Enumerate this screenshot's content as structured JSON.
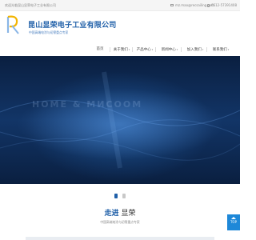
{
  "topbar": {
    "welcome": "欢迎光临昆山显荣电子工业有限公司",
    "email": "mz.mao@recsailing.com",
    "phone": "0512-57391408"
  },
  "logo": {
    "company_name": "昆山显荣电子工业有限公司",
    "slogan": "中国高端电涂与初筛重点专家"
  },
  "nav": {
    "items": [
      {
        "label": "首页",
        "dropdown": false
      },
      {
        "label": "关于我们",
        "dropdown": true
      },
      {
        "label": "产品中心",
        "dropdown": true
      },
      {
        "label": "新闻中心",
        "dropdown": true
      },
      {
        "label": "加入我们",
        "dropdown": true
      },
      {
        "label": "联系我们",
        "dropdown": true
      }
    ]
  },
  "banner": {
    "overlay_text": "НОМЕ & МИСООМ"
  },
  "carousel": {
    "current": 1,
    "total": 2
  },
  "about": {
    "title_highlight": "走进",
    "title_rest": "显荣",
    "subtitle": "中国高端电涂与初筛重点专家"
  },
  "totop": {
    "label": "TOP"
  },
  "colors": {
    "brand_blue": "#1f5fa8",
    "totop_blue": "#1e88d8",
    "banner_dark": "#0b2347"
  }
}
